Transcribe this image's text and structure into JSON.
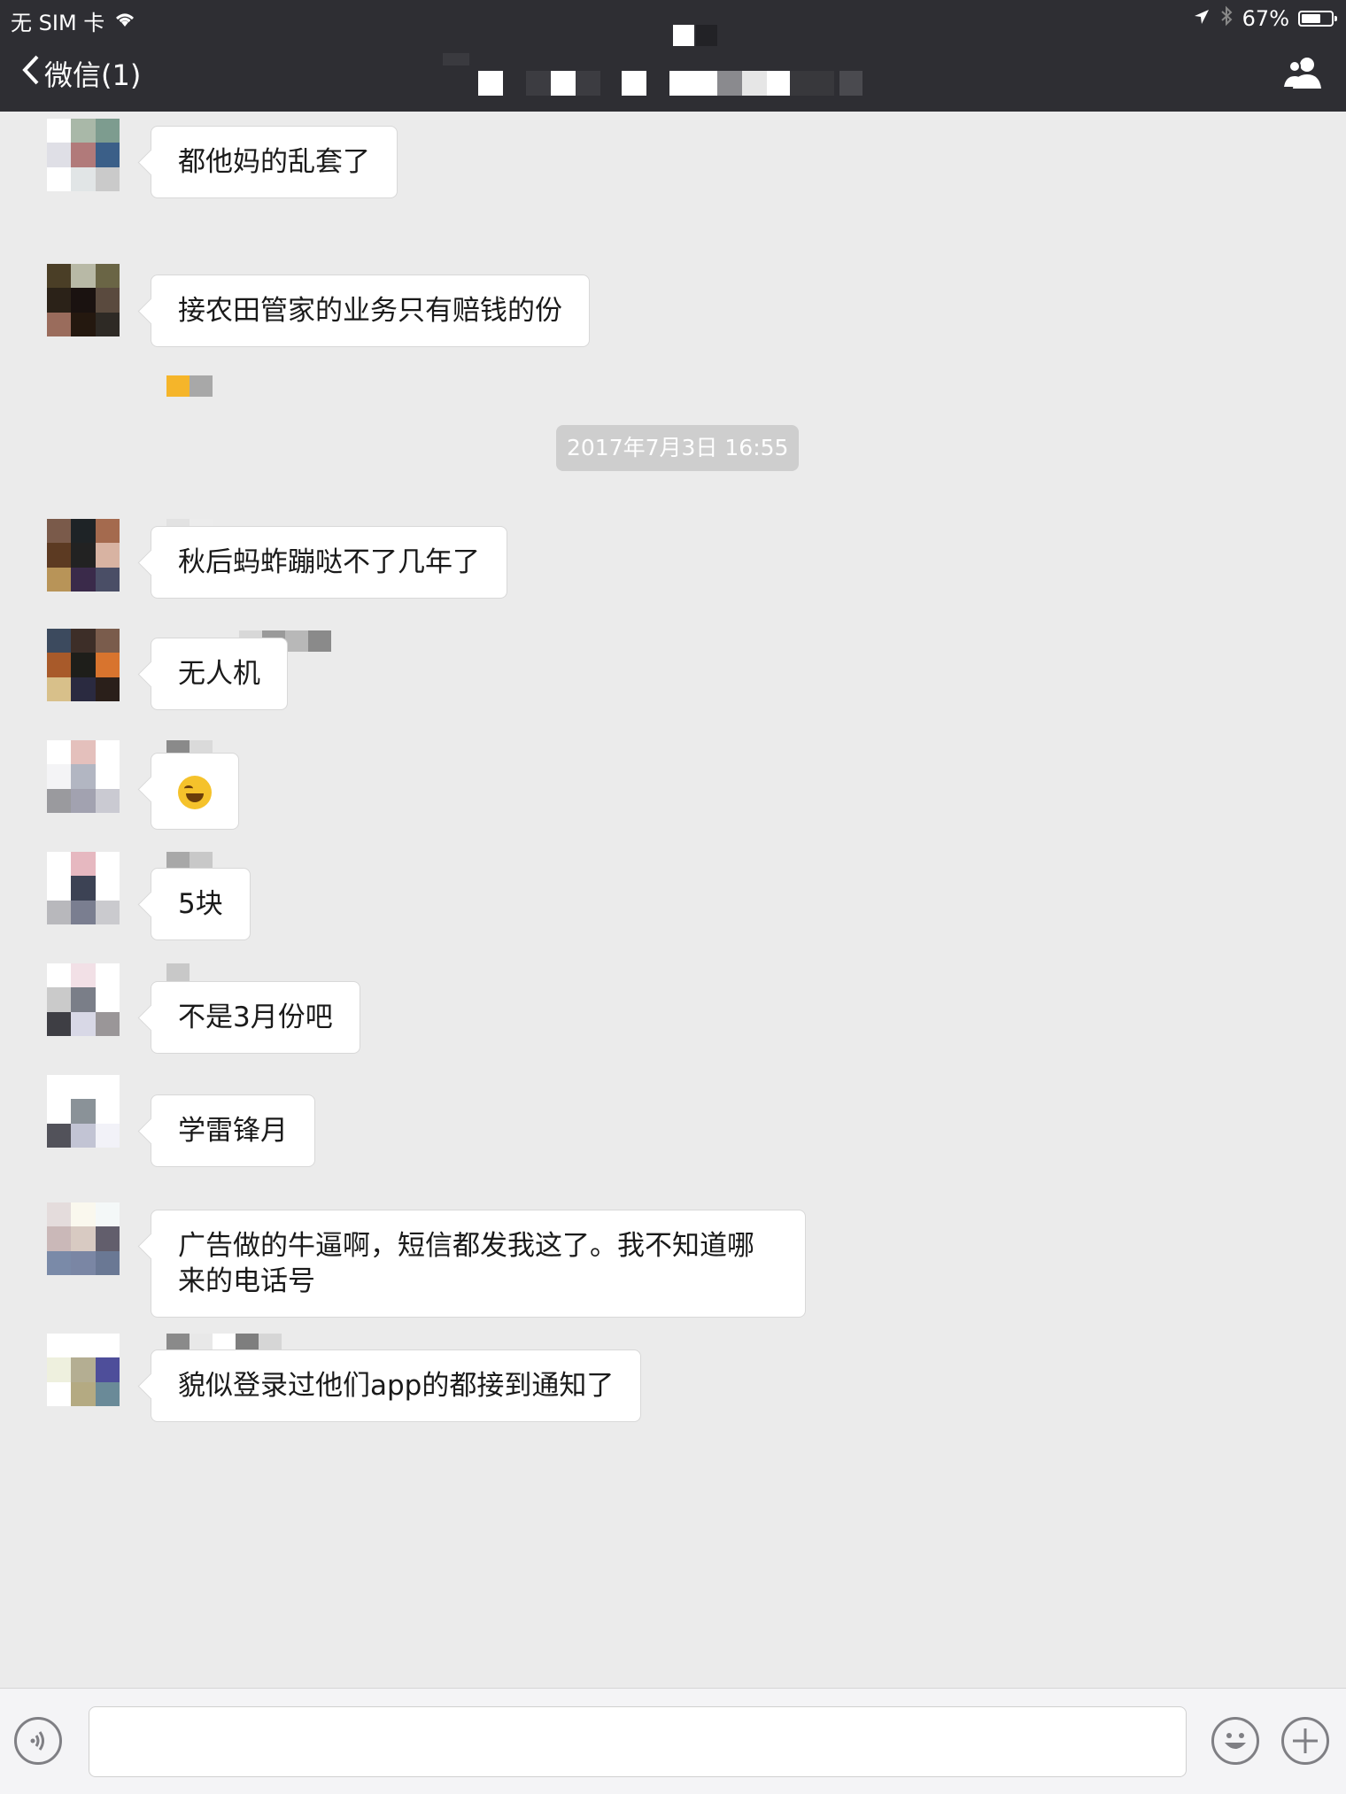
{
  "status_bar": {
    "carrier": "无 SIM 卡",
    "battery": "67%",
    "battery_level": 0.67,
    "icons": [
      "wifi-icon",
      "location-arrow-icon",
      "bluetooth-icon",
      "battery-icon"
    ]
  },
  "nav": {
    "back_label": "微信(1)",
    "group_icon": "group-members-icon"
  },
  "timestamp": "2017年7月3日 16:55",
  "messages": [
    {
      "text": "都他妈的乱套了"
    },
    {
      "text": "接农田管家的业务只有赔钱的份"
    },
    {
      "text": "秋后蚂蚱蹦哒不了几年了"
    },
    {
      "text": "无人机"
    },
    {
      "text": "",
      "emoji": "laughing-crying-emoji"
    },
    {
      "text": "5块"
    },
    {
      "text": "不是3月份吧"
    },
    {
      "text": "学雷锋月"
    },
    {
      "text": "广告做的牛逼啊，短信都发我这了。我不知道哪来的电话号"
    },
    {
      "text": "貌似登录过他们app的都接到通知了"
    }
  ],
  "input_bar": {
    "icons": [
      "voice-icon",
      "emoji-icon",
      "plus-icon"
    ]
  }
}
